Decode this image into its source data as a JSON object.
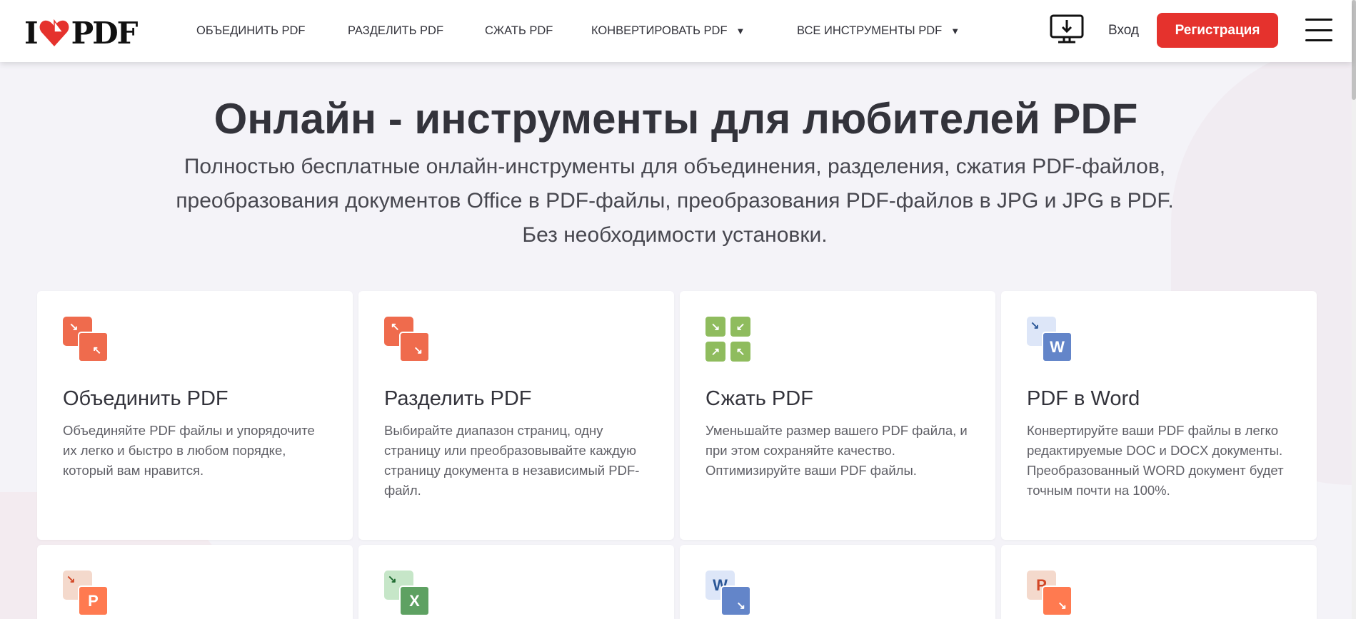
{
  "header": {
    "logo": "I ❤ PDF",
    "nav": [
      {
        "label": "ОБЪЕДИНИТЬ PDF"
      },
      {
        "label": "РАЗДЕЛИТЬ PDF"
      },
      {
        "label": "СЖАТЬ PDF"
      },
      {
        "label": "КОНВЕРТИРОВАТЬ PDF",
        "dropdown": true
      },
      {
        "label": "ВСЕ ИНСТРУМЕНТЫ PDF",
        "dropdown": true
      }
    ],
    "login": "Вход",
    "register": "Регистрация",
    "icons": [
      "desktop-download-icon",
      "hamburger-menu-icon"
    ]
  },
  "hero": {
    "title": "Онлайн - инструменты для любителей PDF",
    "subtitle": "Полностью бесплатные онлайн-инструменты для объединения, разделения, сжатия PDF-файлов, преобразования документов Office в PDF-файлы, преобразования PDF-файлов в JPG и JPG в PDF. Без необходимости установки."
  },
  "tools": [
    {
      "title": "Объединить PDF",
      "desc": "Объединяйте PDF файлы и упорядочите их легко и быстро в любом порядке, который вам нравится."
    },
    {
      "title": "Разделить PDF",
      "desc": "Выбирайте диапазон страниц, одну страницу или преобразовывайте каждую страницу документа в независимый PDF-файл."
    },
    {
      "title": "Сжать PDF",
      "desc": "Уменьшайте размер вашего PDF файла, и при этом сохраняйте качество. Оптимизируйте ваши PDF файлы."
    },
    {
      "title": "PDF в Word",
      "desc": "Конвертируйте ваши PDF файлы в легко редактируемые DOC и DOCX документы. Преобразованный WORD документ будет точным почти на 100%.",
      "letter": "W"
    },
    {
      "letter": "P"
    },
    {
      "letter": "X"
    },
    {
      "letter": "W"
    },
    {
      "letter": "P"
    }
  ],
  "colors": {
    "brand": "#e5322d",
    "merge": "#ef6b4d",
    "compress": "#8fbc5e",
    "word": "#6385c9",
    "ppt": "#ff7a50",
    "excel": "#5ea162"
  }
}
